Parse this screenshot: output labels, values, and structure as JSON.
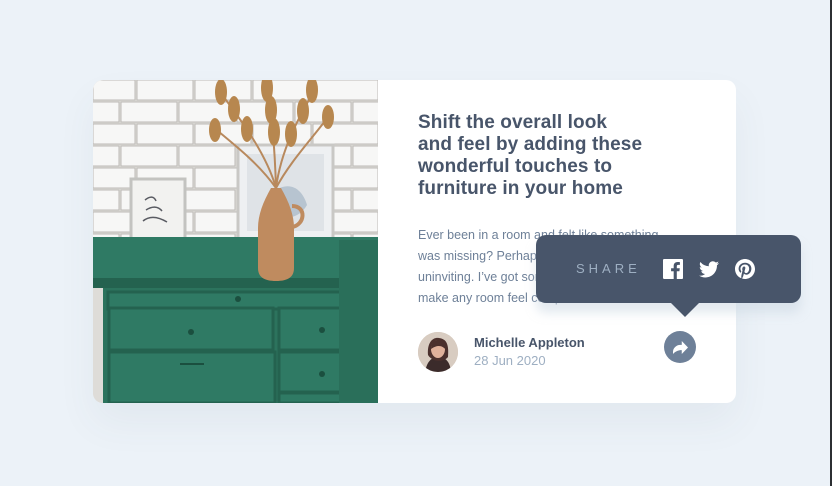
{
  "article": {
    "title": "Shift the overall look\nand feel by adding these\nwonderful touches to\nfurniture in your home",
    "description": "Ever been in a room and felt like something was missing? Perhaps it felt slightly bare and uninviting. I’ve got some simple tips to help you make any room feel complete."
  },
  "author": {
    "name": "Michelle Appleton",
    "date": "28 Jun 2020"
  },
  "share": {
    "label": "SHARE",
    "icons": [
      "facebook-icon",
      "twitter-icon",
      "pinterest-icon",
      "share-icon"
    ]
  },
  "colors": {
    "page_background": "#ecf2f8",
    "title_text": "#48556a",
    "body_text": "#6e8098",
    "muted_text": "#9eafc2",
    "tooltip_background": "#48556a",
    "share_button": "#6e8098",
    "dresser_green": "#2f7a64"
  }
}
